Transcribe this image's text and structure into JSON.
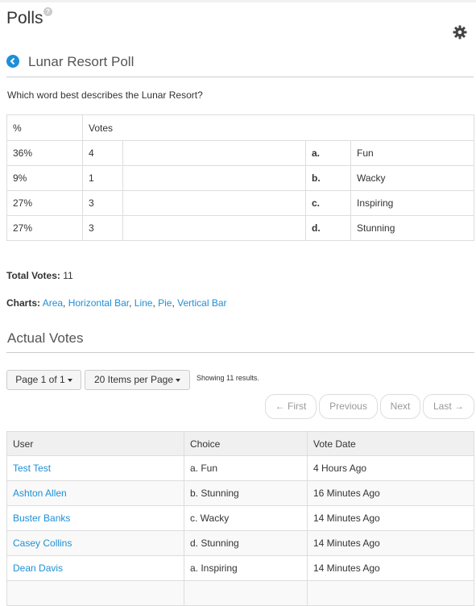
{
  "app": {
    "title": "Polls",
    "help": "?"
  },
  "poll": {
    "title": "Lunar Resort Poll",
    "question": "Which word best describes the Lunar Resort?"
  },
  "results": {
    "headers": {
      "percent": "%",
      "votes": "Votes"
    },
    "rows": [
      {
        "percent": "36%",
        "votes": "4",
        "letter": "a.",
        "choice": "Fun"
      },
      {
        "percent": "9%",
        "votes": "1",
        "letter": "b.",
        "choice": "Wacky"
      },
      {
        "percent": "27%",
        "votes": "3",
        "letter": "c.",
        "choice": "Inspiring"
      },
      {
        "percent": "27%",
        "votes": "3",
        "letter": "d.",
        "choice": "Stunning"
      }
    ]
  },
  "total": {
    "label": "Total Votes:",
    "value": "11"
  },
  "charts": {
    "label": "Charts:",
    "links": [
      "Area",
      "Horizontal Bar",
      "Line",
      "Pie",
      "Vertical Bar"
    ]
  },
  "actual_votes": {
    "title": "Actual Votes",
    "page_button": "Page 1 of 1",
    "items_button": "20 Items per Page",
    "showing": "Showing 11 results.",
    "nav": {
      "first": "← First",
      "previous": "Previous",
      "next": "Next",
      "last": "Last →"
    },
    "headers": {
      "user": "User",
      "choice": "Choice",
      "date": "Vote Date"
    },
    "rows": [
      {
        "user": "Test Test",
        "choice": "a. Fun",
        "date": "4 Hours Ago"
      },
      {
        "user": "Ashton Allen",
        "choice": "b. Stunning",
        "date": "16 Minutes Ago"
      },
      {
        "user": "Buster Banks",
        "choice": "c. Wacky",
        "date": "14 Minutes Ago"
      },
      {
        "user": "Casey Collins",
        "choice": "d. Stunning",
        "date": "14 Minutes Ago"
      },
      {
        "user": "Dean Davis",
        "choice": "a. Inspiring",
        "date": "14 Minutes Ago"
      }
    ]
  },
  "colors": {
    "accent": "#1e8fd6"
  }
}
